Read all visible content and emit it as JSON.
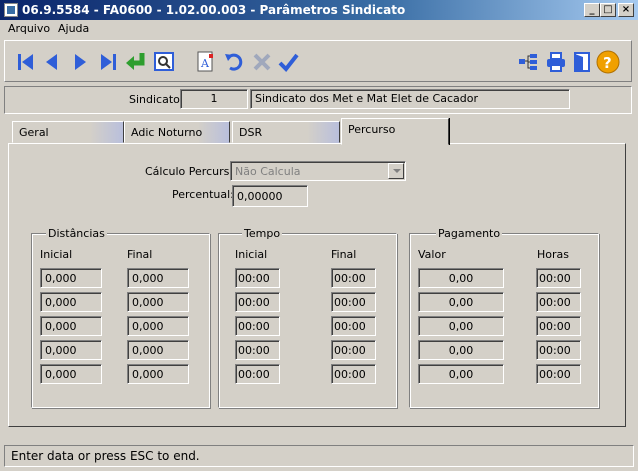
{
  "window": {
    "title": "06.9.5584 - FA0600 - 1.02.00.003 - Parâmetros Sindicato",
    "minimize_glyph": "_",
    "maximize_glyph": "□",
    "close_glyph": "×"
  },
  "menu": {
    "items": [
      "Arquivo",
      "Ajuda"
    ]
  },
  "toolbar": {
    "buttons": [
      "first-record-icon",
      "previous-record-icon",
      "next-record-icon",
      "last-record-icon",
      "goto-icon",
      "zoom-icon",
      "edit-icon",
      "undo-icon",
      "delete-icon",
      "confirm-icon",
      "tree-icon",
      "print-icon",
      "exit-icon",
      "help-icon"
    ],
    "colors": {
      "nav": "#2f5ed8",
      "goto": "#2e9e2e",
      "help": "#f0a000"
    }
  },
  "header": {
    "sindicato_label": "Sindicato:",
    "sindicato_code": "1",
    "sindicato_name": "Sindicato dos Met e Mat Elet de Cacador"
  },
  "tabs": [
    {
      "label": "Geral",
      "active": false
    },
    {
      "label": "Adic Noturno",
      "active": false
    },
    {
      "label": "DSR",
      "active": false
    },
    {
      "label": "Percurso",
      "active": true
    }
  ],
  "percurso": {
    "calculo_label": "Cálculo Percurso:",
    "calculo_value": "Não Calcula",
    "percentual_label": "Percentual:",
    "percentual_value": "0,00000",
    "distancias": {
      "title": "Distâncias",
      "col1": "Inicial",
      "col2": "Final",
      "inicial": [
        "0,000",
        "0,000",
        "0,000",
        "0,000",
        "0,000"
      ],
      "final": [
        "0,000",
        "0,000",
        "0,000",
        "0,000",
        "0,000"
      ]
    },
    "tempo": {
      "title": "Tempo",
      "col1": "Inicial",
      "col2": "Final",
      "inicial": [
        "00:00",
        "00:00",
        "00:00",
        "00:00",
        "00:00"
      ],
      "final": [
        "00:00",
        "00:00",
        "00:00",
        "00:00",
        "00:00"
      ]
    },
    "pagamento": {
      "title": "Pagamento",
      "col1": "Valor",
      "col2": "Horas",
      "valor": [
        "0,00",
        "0,00",
        "0,00",
        "0,00",
        "0,00"
      ],
      "horas": [
        "00:00",
        "00:00",
        "00:00",
        "00:00",
        "00:00"
      ]
    }
  },
  "status": {
    "text": "Enter data or press ESC to end."
  }
}
